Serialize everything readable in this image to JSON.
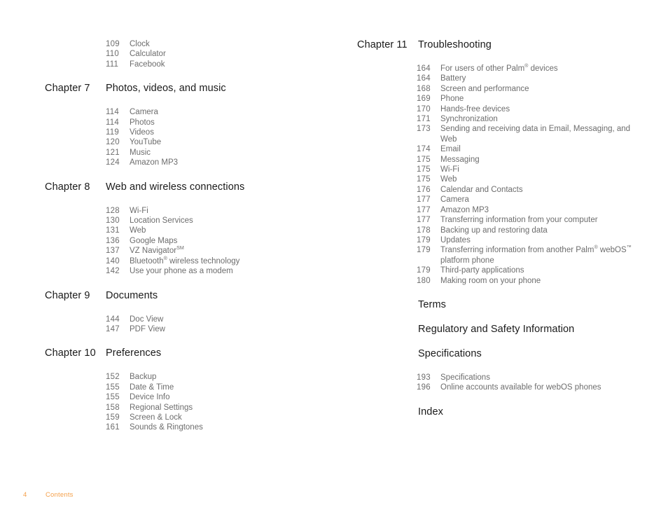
{
  "document": {
    "kind": "table-of-contents",
    "footer": {
      "page_number": "4",
      "section_name": "Contents"
    },
    "colors": {
      "heading_text": "#1a1a1a",
      "entry_text": "#6d6d6d",
      "footer_accent": "#F5A04A",
      "background": "#ffffff"
    }
  },
  "left_column": {
    "leading_entries": [
      {
        "page": "109",
        "title": "Clock"
      },
      {
        "page": "110",
        "title": "Calculator"
      },
      {
        "page": "111",
        "title": "Facebook"
      }
    ],
    "chapters": [
      {
        "label": "Chapter 7",
        "title": "Photos, videos, and music",
        "entries": [
          {
            "page": "114",
            "title": "Camera"
          },
          {
            "page": "114",
            "title": "Photos"
          },
          {
            "page": "119",
            "title": "Videos"
          },
          {
            "page": "120",
            "title": "YouTube"
          },
          {
            "page": "121",
            "title": "Music"
          },
          {
            "page": "124",
            "title": "Amazon MP3"
          }
        ]
      },
      {
        "label": "Chapter 8",
        "title": "Web and wireless connections",
        "entries": [
          {
            "page": "128",
            "title": "Wi-Fi"
          },
          {
            "page": "130",
            "title": "Location Services"
          },
          {
            "page": "131",
            "title": "Web"
          },
          {
            "page": "136",
            "title": "Google Maps"
          },
          {
            "page": "137",
            "title": "VZ Navigator",
            "sup": "SM"
          },
          {
            "page": "140",
            "title": "Bluetooth",
            "sup": "®",
            "title_after": " wireless technology"
          },
          {
            "page": "142",
            "title": "Use your phone as a modem"
          }
        ]
      },
      {
        "label": "Chapter 9",
        "title": "Documents",
        "entries": [
          {
            "page": "144",
            "title": "Doc View"
          },
          {
            "page": "147",
            "title": "PDF View"
          }
        ]
      },
      {
        "label": "Chapter 10",
        "title": "Preferences",
        "entries": [
          {
            "page": "152",
            "title": "Backup"
          },
          {
            "page": "155",
            "title": "Date & Time"
          },
          {
            "page": "155",
            "title": "Device Info"
          },
          {
            "page": "158",
            "title": "Regional Settings"
          },
          {
            "page": "159",
            "title": "Screen & Lock"
          },
          {
            "page": "161",
            "title": "Sounds & Ringtones"
          }
        ]
      }
    ]
  },
  "right_column": {
    "chapters": [
      {
        "label": "Chapter 11",
        "title": "Troubleshooting",
        "entries": [
          {
            "page": "164",
            "title": "For users of other Palm",
            "sup": "®",
            "title_after": " devices"
          },
          {
            "page": "164",
            "title": "Battery"
          },
          {
            "page": "168",
            "title": "Screen and performance"
          },
          {
            "page": "169",
            "title": "Phone"
          },
          {
            "page": "170",
            "title": "Hands-free devices"
          },
          {
            "page": "171",
            "title": "Synchronization"
          },
          {
            "page": "173",
            "title": "Sending and receiving data in Email, Messaging, and Web"
          },
          {
            "page": "174",
            "title": "Email"
          },
          {
            "page": "175",
            "title": "Messaging"
          },
          {
            "page": "175",
            "title": "Wi-Fi"
          },
          {
            "page": "175",
            "title": "Web"
          },
          {
            "page": "176",
            "title": "Calendar and Contacts"
          },
          {
            "page": "177",
            "title": "Camera"
          },
          {
            "page": "177",
            "title": "Amazon MP3"
          },
          {
            "page": "177",
            "title": "Transferring information from your computer"
          },
          {
            "page": "178",
            "title": "Backing up and restoring data"
          },
          {
            "page": "179",
            "title": "Updates"
          },
          {
            "page": "179",
            "title": "Transferring information from another Palm",
            "sup": "®",
            "title_after": " webOS",
            "sup2": "™",
            "title_after2": " platform phone"
          },
          {
            "page": "179",
            "title": "Third-party applications"
          },
          {
            "page": "180",
            "title": "Making room on your phone"
          }
        ]
      },
      {
        "label": "",
        "title": "Terms",
        "entries": []
      },
      {
        "label": "",
        "title": "Regulatory and Safety Information",
        "entries": []
      },
      {
        "label": "",
        "title": "Specifications",
        "entries": [
          {
            "page": "193",
            "title": "Specifications"
          },
          {
            "page": "196",
            "title": "Online accounts available for webOS phones"
          }
        ]
      },
      {
        "label": "",
        "title": "Index",
        "entries": []
      }
    ]
  }
}
